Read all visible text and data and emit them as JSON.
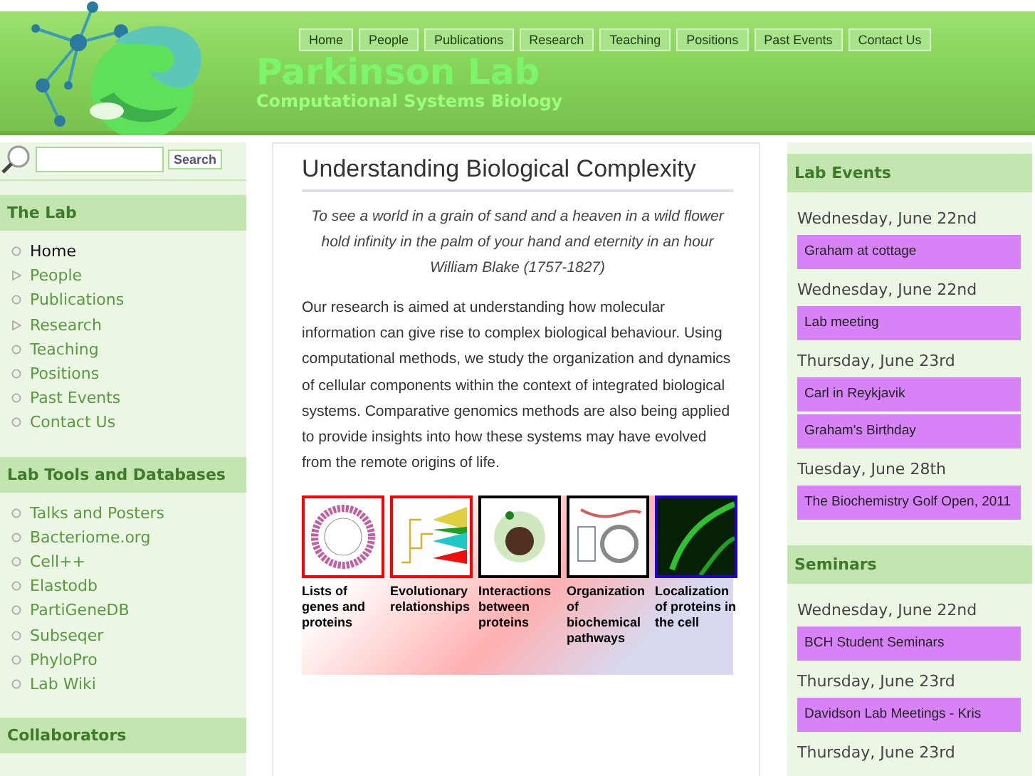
{
  "header": {
    "title": "Parkinson Lab",
    "subtitle": "Computational Systems Biology"
  },
  "nav": [
    {
      "label": "Home"
    },
    {
      "label": "People"
    },
    {
      "label": "Publications"
    },
    {
      "label": "Research"
    },
    {
      "label": "Teaching"
    },
    {
      "label": "Positions"
    },
    {
      "label": "Past Events"
    },
    {
      "label": "Contact Us"
    }
  ],
  "search": {
    "button": "Search"
  },
  "sidebar": [
    {
      "title": "The Lab",
      "items": [
        {
          "label": "Home",
          "kind": "circle",
          "selected": true
        },
        {
          "label": "People",
          "kind": "triangle",
          "selected": false
        },
        {
          "label": "Publications",
          "kind": "circle",
          "selected": false
        },
        {
          "label": "Research",
          "kind": "triangle",
          "selected": false
        },
        {
          "label": "Teaching",
          "kind": "circle",
          "selected": false
        },
        {
          "label": "Positions",
          "kind": "circle",
          "selected": false
        },
        {
          "label": "Past Events",
          "kind": "circle",
          "selected": false
        },
        {
          "label": "Contact Us",
          "kind": "circle",
          "selected": false
        }
      ]
    },
    {
      "title": "Lab Tools and Databases",
      "items": [
        {
          "label": "Talks and Posters",
          "kind": "circle",
          "selected": false
        },
        {
          "label": "Bacteriome.org",
          "kind": "circle",
          "selected": false
        },
        {
          "label": "Cell++",
          "kind": "circle",
          "selected": false
        },
        {
          "label": "Elastodb",
          "kind": "circle",
          "selected": false
        },
        {
          "label": "PartiGeneDB",
          "kind": "circle",
          "selected": false
        },
        {
          "label": "Subseqer",
          "kind": "circle",
          "selected": false
        },
        {
          "label": "PhyloPro",
          "kind": "circle",
          "selected": false
        },
        {
          "label": "Lab Wiki",
          "kind": "circle",
          "selected": false
        }
      ]
    },
    {
      "title": "Collaborators"
    }
  ],
  "main": {
    "heading": "Understanding Biological Complexity",
    "quote": [
      "To see a world in a grain of sand and a heaven in a wild flower",
      "hold infinity in the palm of your hand and eternity in an hour",
      "William Blake (1757-1827)"
    ],
    "body": "Our research is aimed at understanding how molecular information can give rise to complex biological behaviour. Using computational methods, we study the organization and dynamics of cellular components within the context of integrated biological systems. Comparative genomics methods are also being applied to provide insights into how these systems may have evolved from the remote origins of life.",
    "figure": [
      {
        "caption": "Lists of genes and proteins",
        "color": "#ff0000",
        "kind": "ring"
      },
      {
        "caption": "Evolutionary relationships",
        "color": "#ff0000",
        "kind": "tree"
      },
      {
        "caption": "Interactions between proteins",
        "color": "#000000",
        "kind": "network"
      },
      {
        "caption": "Organization of biochemical pathways",
        "color": "#000000",
        "kind": "pathway"
      },
      {
        "caption": "Localization of proteins in the cell",
        "color": "#2200cc",
        "kind": "cell"
      }
    ]
  },
  "panels": [
    {
      "title": "Lab Events",
      "days": [
        {
          "date": "Wednesday, June 22nd",
          "events": [
            "Graham at cottage"
          ]
        },
        {
          "date": "Wednesday, June 22nd",
          "events": [
            "Lab meeting"
          ]
        },
        {
          "date": "Thursday, June 23rd",
          "events": [
            "Carl in Reykjavik",
            "Graham's Birthday"
          ]
        },
        {
          "date": "Tuesday, June 28th",
          "events": [
            "The Biochemistry Golf Open, 2011"
          ]
        }
      ]
    },
    {
      "title": "Seminars",
      "days": [
        {
          "date": "Wednesday, June 22nd",
          "events": [
            "BCH Student Seminars"
          ]
        },
        {
          "date": "Thursday, June 23rd",
          "events": [
            "Davidson Lab Meetings - Kris"
          ]
        },
        {
          "date": "Thursday, June 23rd"
        }
      ]
    }
  ]
}
